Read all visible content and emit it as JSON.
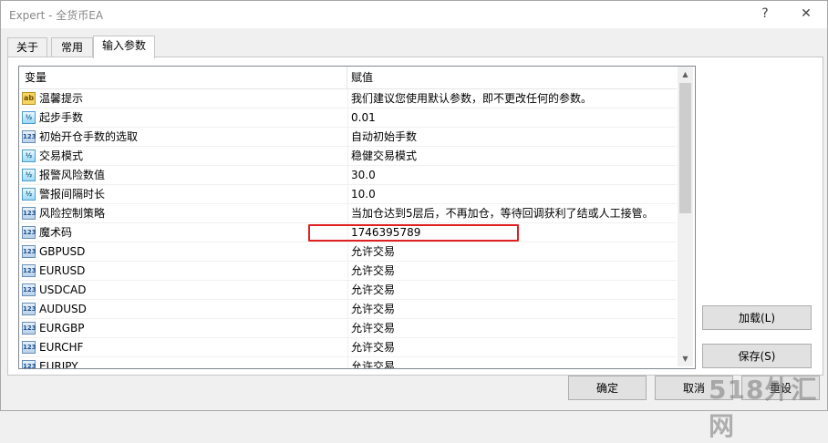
{
  "window": {
    "title": "Expert - 全货币EA",
    "help_icon": "?",
    "close_icon": "✕"
  },
  "tabs": [
    {
      "label": "关于"
    },
    {
      "label": "常用"
    },
    {
      "label": "输入参数",
      "active": true
    }
  ],
  "grid": {
    "headers": {
      "variable": "变量",
      "value": "赋值"
    },
    "rows": [
      {
        "icon": "ab",
        "name": "温馨提示",
        "value": "我们建议您使用默认参数，即不更改任何的参数。"
      },
      {
        "icon": "½",
        "name": "起步手数",
        "value": "0.01"
      },
      {
        "icon": "123",
        "name": "初始开仓手数的选取",
        "value": "自动初始手数"
      },
      {
        "icon": "½",
        "name": "交易模式",
        "value": "稳健交易模式"
      },
      {
        "icon": "½",
        "name": "报警风险数值",
        "value": "30.0"
      },
      {
        "icon": "½",
        "name": "警报间隔时长",
        "value": "10.0"
      },
      {
        "icon": "123",
        "name": "风险控制策略",
        "value": "当加仓达到5层后，不再加仓，等待回调获利了结或人工接管。"
      },
      {
        "icon": "123",
        "name": "魔术码",
        "value": "1746395789"
      },
      {
        "icon": "123",
        "name": "GBPUSD",
        "value": "允许交易"
      },
      {
        "icon": "123",
        "name": "EURUSD",
        "value": "允许交易"
      },
      {
        "icon": "123",
        "name": "USDCAD",
        "value": "允许交易"
      },
      {
        "icon": "123",
        "name": "AUDUSD",
        "value": "允许交易"
      },
      {
        "icon": "123",
        "name": "EURGBP",
        "value": "允许交易"
      },
      {
        "icon": "123",
        "name": "EURCHF",
        "value": "允许交易"
      },
      {
        "icon": "123",
        "name": "EURJPY",
        "value": "允许交易"
      }
    ],
    "scroll_up_icon": "▲",
    "scroll_down_icon": "▼"
  },
  "buttons": {
    "load": "加载(L)",
    "save": "保存(S)",
    "ok": "确定",
    "cancel": "取消",
    "reset": "重设"
  },
  "watermark": "518外汇网",
  "colors": {
    "highlight_border": "#e02020"
  }
}
